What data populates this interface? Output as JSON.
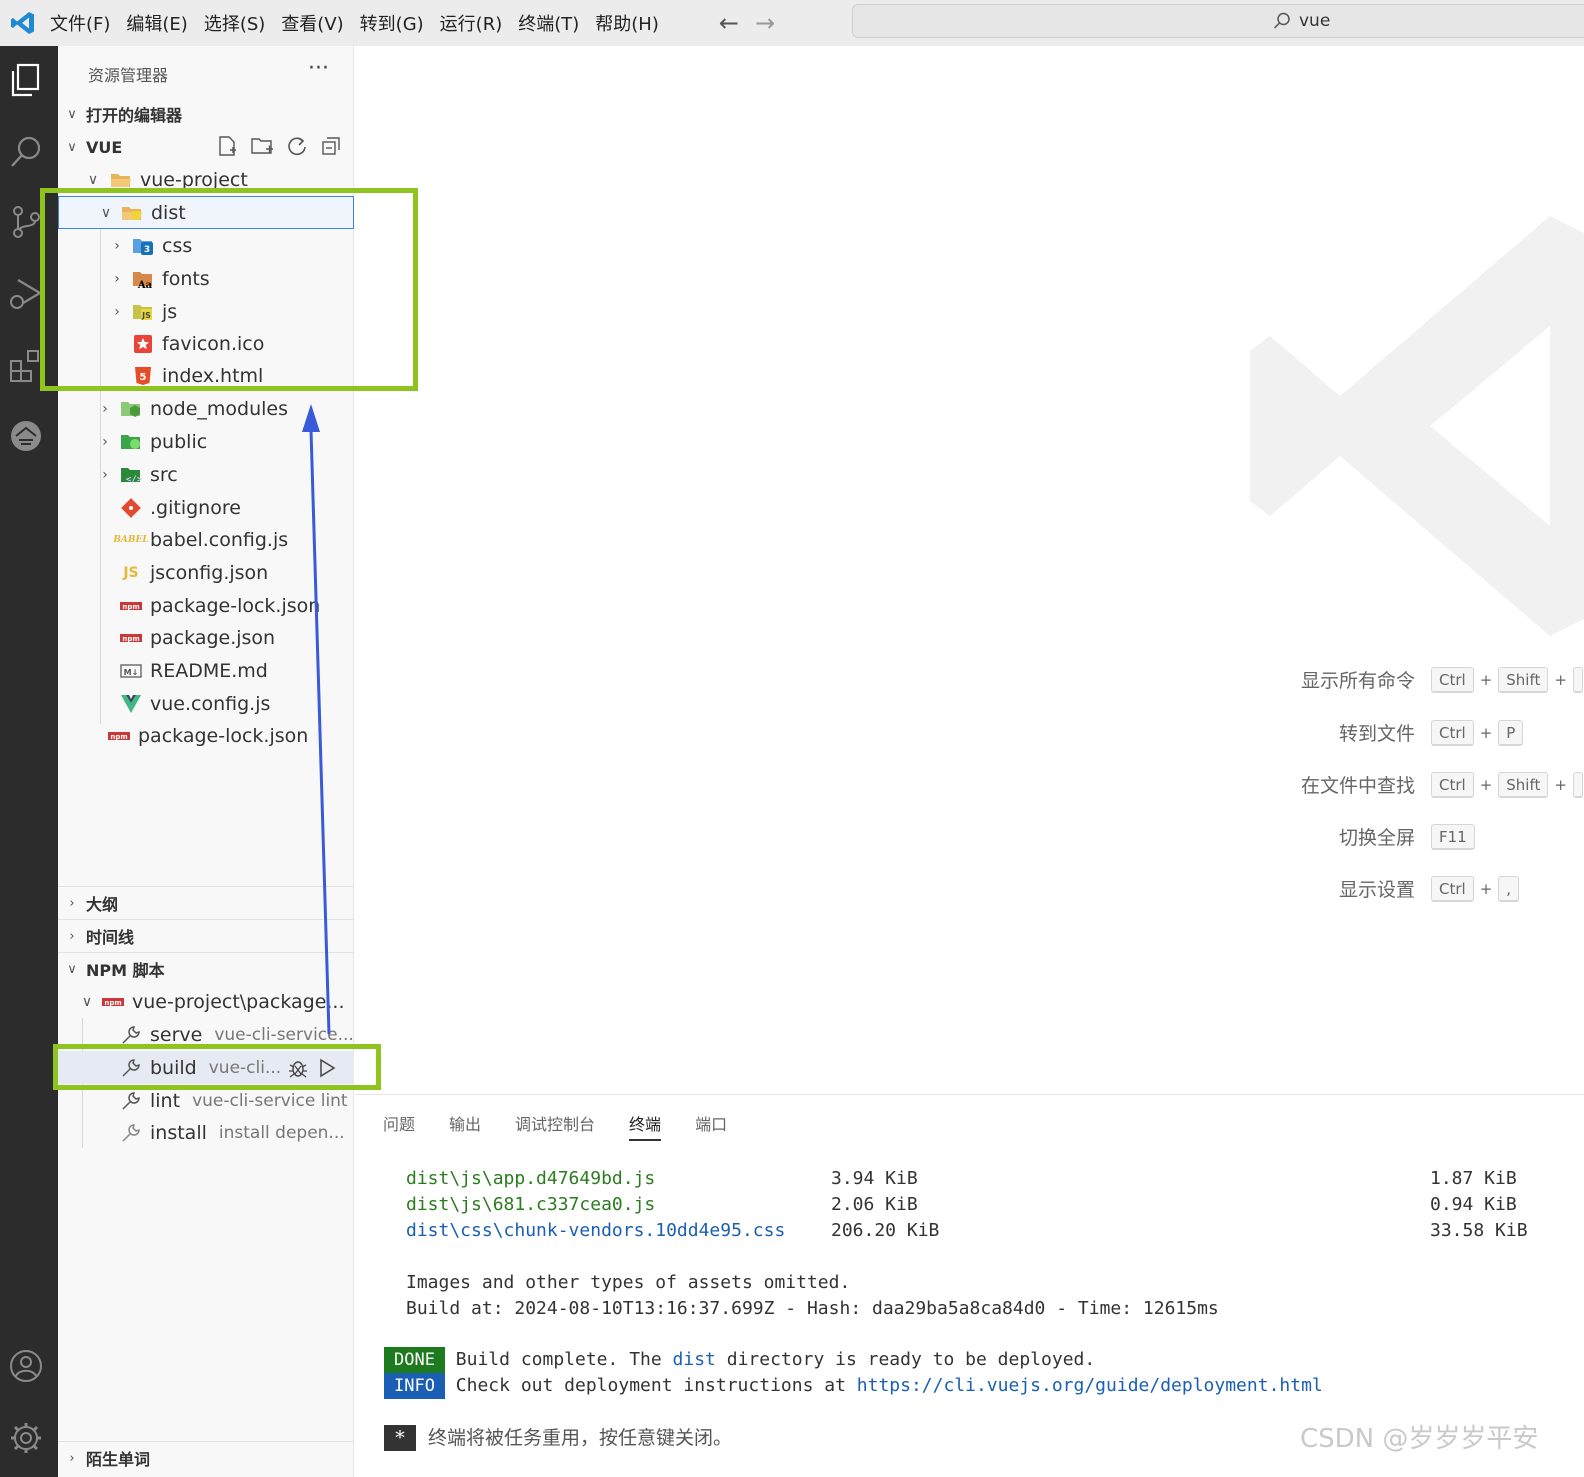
{
  "menu": [
    "文件(F)",
    "编辑(E)",
    "选择(S)",
    "查看(V)",
    "转到(G)",
    "运行(R)",
    "终端(T)",
    "帮助(H)"
  ],
  "search": {
    "value": "vue"
  },
  "nav": {
    "back": "←",
    "forward": "→"
  },
  "sidebar": {
    "title": "资源管理器",
    "more": "···",
    "open_editors": "打开的编辑器",
    "workspace": "VUE",
    "outline": "大纲",
    "timeline": "时间线",
    "npm_scripts": "NPM 脚本",
    "bottom_section": "陌生单词"
  },
  "tree": [
    {
      "label": "vue-project",
      "icon": "folder-open-icon"
    },
    {
      "label": "dist",
      "icon": "folder-dist-icon"
    },
    {
      "label": "css",
      "icon": "folder-css-icon"
    },
    {
      "label": "fonts",
      "icon": "folder-fonts-icon"
    },
    {
      "label": "js",
      "icon": "folder-js-icon"
    },
    {
      "label": "favicon.ico",
      "icon": "favicon-icon"
    },
    {
      "label": "index.html",
      "icon": "html-icon"
    },
    {
      "label": "node_modules",
      "icon": "folder-node-icon"
    },
    {
      "label": "public",
      "icon": "folder-public-icon"
    },
    {
      "label": "src",
      "icon": "folder-src-icon"
    },
    {
      "label": ".gitignore",
      "icon": "git-icon"
    },
    {
      "label": "babel.config.js",
      "icon": "babel-icon"
    },
    {
      "label": "jsconfig.json",
      "icon": "js-icon"
    },
    {
      "label": "package-lock.json",
      "icon": "npm-icon"
    },
    {
      "label": "package.json",
      "icon": "npm-icon"
    },
    {
      "label": "README.md",
      "icon": "markdown-icon"
    },
    {
      "label": "vue.config.js",
      "icon": "vue-icon"
    },
    {
      "label": "package-lock.json",
      "icon": "npm-icon"
    }
  ],
  "npm": {
    "project": "vue-project\\package...",
    "scripts": [
      {
        "name": "serve",
        "cmd": "vue-cli-service..."
      },
      {
        "name": "build",
        "cmd": "vue-cli..."
      },
      {
        "name": "lint",
        "cmd": "vue-cli-service lint"
      },
      {
        "name": "install",
        "cmd": "install depen..."
      }
    ]
  },
  "hints": [
    {
      "label": "显示所有命令",
      "keys": [
        "Ctrl",
        "Shift",
        ""
      ]
    },
    {
      "label": "转到文件",
      "keys": [
        "Ctrl",
        "P"
      ]
    },
    {
      "label": "在文件中查找",
      "keys": [
        "Ctrl",
        "Shift",
        ""
      ]
    },
    {
      "label": "切换全屏",
      "keys": [
        "F11"
      ]
    },
    {
      "label": "显示设置",
      "keys": [
        "Ctrl",
        ","
      ]
    }
  ],
  "panel": {
    "tabs": [
      "问题",
      "输出",
      "调试控制台",
      "终端",
      "端口"
    ],
    "active_tab": "终端",
    "assets": [
      {
        "file": "dist\\js\\app.d47649bd.js",
        "size": "3.94 KiB",
        "gzip": "1.87 KiB"
      },
      {
        "file": "dist\\js\\681.c337cea0.js",
        "size": "2.06 KiB",
        "gzip": "0.94 KiB"
      },
      {
        "file": "dist\\css\\chunk-vendors.10dd4e95.css",
        "size": "206.20 KiB",
        "gzip": "33.58 KiB"
      }
    ],
    "omitted": "Images and other types of assets omitted.",
    "build_at": "Build at: 2024-08-10T13:16:37.699Z - Hash: daa29ba5a8ca84d0 - Time: 12615ms",
    "done_badge": "DONE",
    "done_pre": "Build complete. The ",
    "done_dist": "dist",
    "done_post": " directory is ready to be deployed.",
    "info_badge": "INFO",
    "info_text": "Check out deployment instructions at ",
    "info_link": "https://cli.vuejs.org/guide/deployment.html",
    "reuse_marker": "*",
    "reuse_text": "终端将被任务重用，按任意键关闭。"
  },
  "watermark": "CSDN @岁岁岁平安",
  "colors": {
    "highlight": "#8fc31f",
    "arrow": "#3a5bd9",
    "done": "#1e7a1e",
    "info": "#1a5fb4"
  }
}
